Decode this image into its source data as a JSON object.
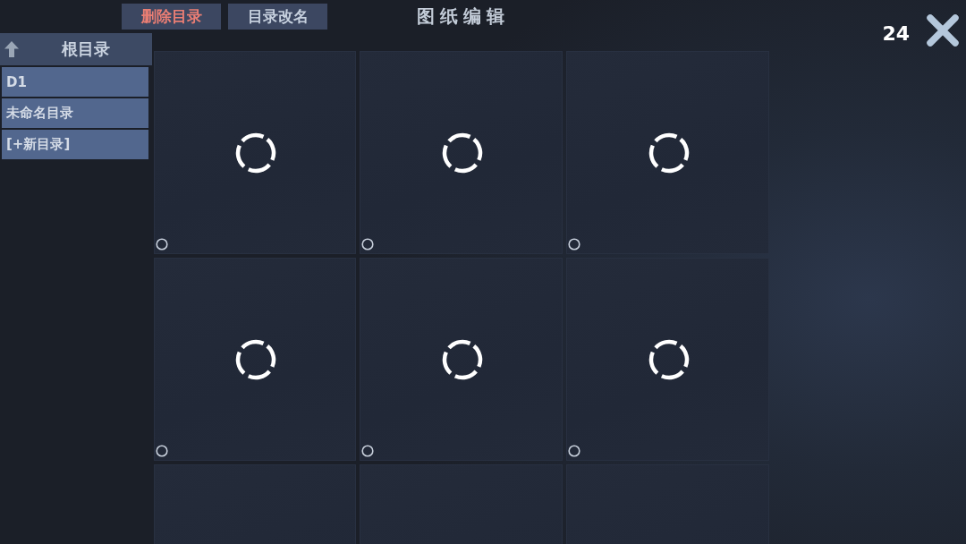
{
  "toolbar": {
    "buttons": [
      {
        "label": "删除目录",
        "kind": "danger"
      },
      {
        "label": "目录改名",
        "kind": "normal"
      }
    ],
    "title": "图纸编辑",
    "count": "24"
  },
  "sidebar": {
    "header": "根目录",
    "items": [
      {
        "label": "D1",
        "selected": false
      },
      {
        "label": "未命名目录",
        "selected": false
      },
      {
        "label": "[+新目录]",
        "selected": false
      }
    ]
  },
  "slots": [
    {
      "kind": "loading",
      "selected": false
    },
    {
      "kind": "loading",
      "selected": false
    },
    {
      "kind": "loading",
      "selected": false
    },
    {
      "kind": "loading",
      "selected": false
    },
    {
      "kind": "loading",
      "selected": false
    },
    {
      "kind": "loading",
      "selected": false
    },
    {
      "kind": "blank"
    },
    {
      "kind": "blank"
    },
    {
      "kind": "blank"
    }
  ]
}
